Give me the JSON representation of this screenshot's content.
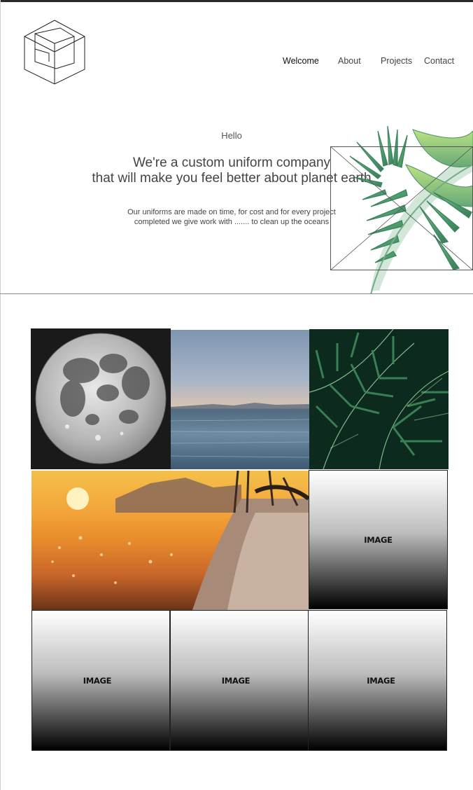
{
  "nav": {
    "items": [
      "Welcome",
      "About",
      "Projects",
      "Contact"
    ]
  },
  "hero": {
    "greeting": "Hello",
    "headline_line1": "We're a custom uniform company",
    "headline_line2": "that will make you feel better about planet earth",
    "subtext_line1": "Our uniforms are made on time, for cost and for every project",
    "subtext_line2": "completed we give work with ....... to clean up the oceans"
  },
  "gallery": {
    "placeholder_label": "IMAGE"
  },
  "colors": {
    "topbar": "#2b2b2b",
    "text": "#444444",
    "divider": "#8a8a8a"
  }
}
